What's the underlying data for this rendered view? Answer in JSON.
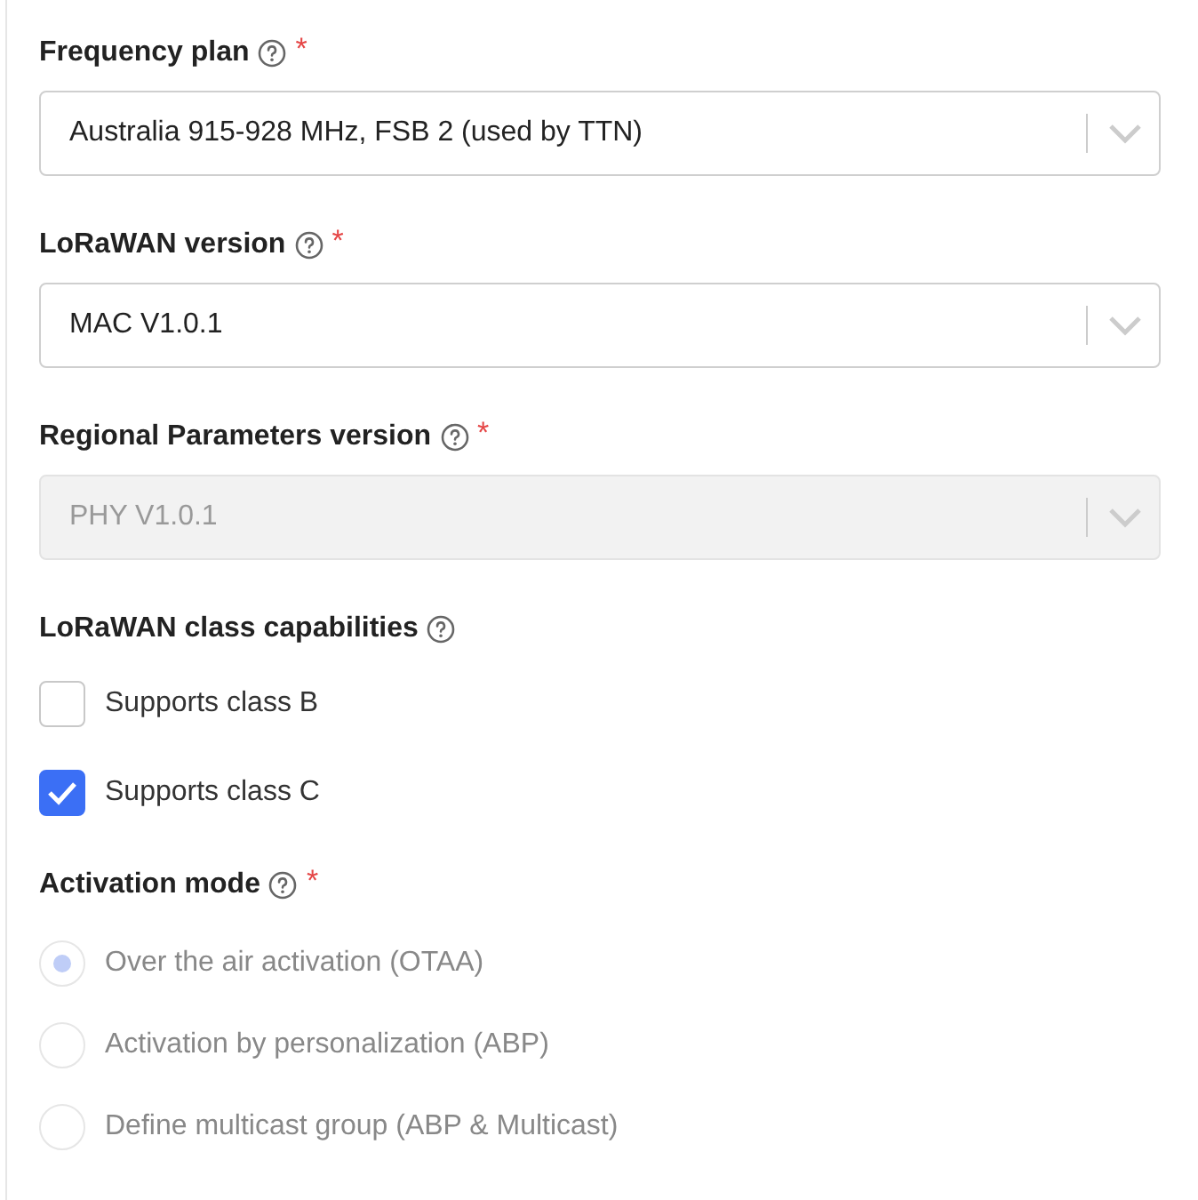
{
  "selects": [
    {
      "label": "Frequency plan",
      "help": true,
      "required_mark": "*",
      "value": "Australia 915-928 MHz, FSB 2 (used by TTN)",
      "disabled": false
    },
    {
      "label": "LoRaWAN version",
      "help": true,
      "required_mark": "*",
      "value": "MAC V1.0.1",
      "disabled": false
    },
    {
      "label": "Regional Parameters version",
      "help": true,
      "required_mark": "*",
      "value": "PHY V1.0.1",
      "disabled": true
    }
  ],
  "class_capabilities": {
    "label": "LoRaWAN class capabilities",
    "help": true,
    "options": [
      {
        "label": "Supports class B",
        "checked": false
      },
      {
        "label": "Supports class C",
        "checked": true
      }
    ]
  },
  "activation_mode": {
    "label": "Activation mode",
    "help": true,
    "required_mark": "*",
    "disabled": true,
    "options": [
      {
        "label": "Over the air activation (OTAA)",
        "selected": true
      },
      {
        "label": "Activation by personalization (ABP)",
        "selected": false
      },
      {
        "label": "Define multicast group (ABP & Multicast)",
        "selected": false
      }
    ]
  }
}
